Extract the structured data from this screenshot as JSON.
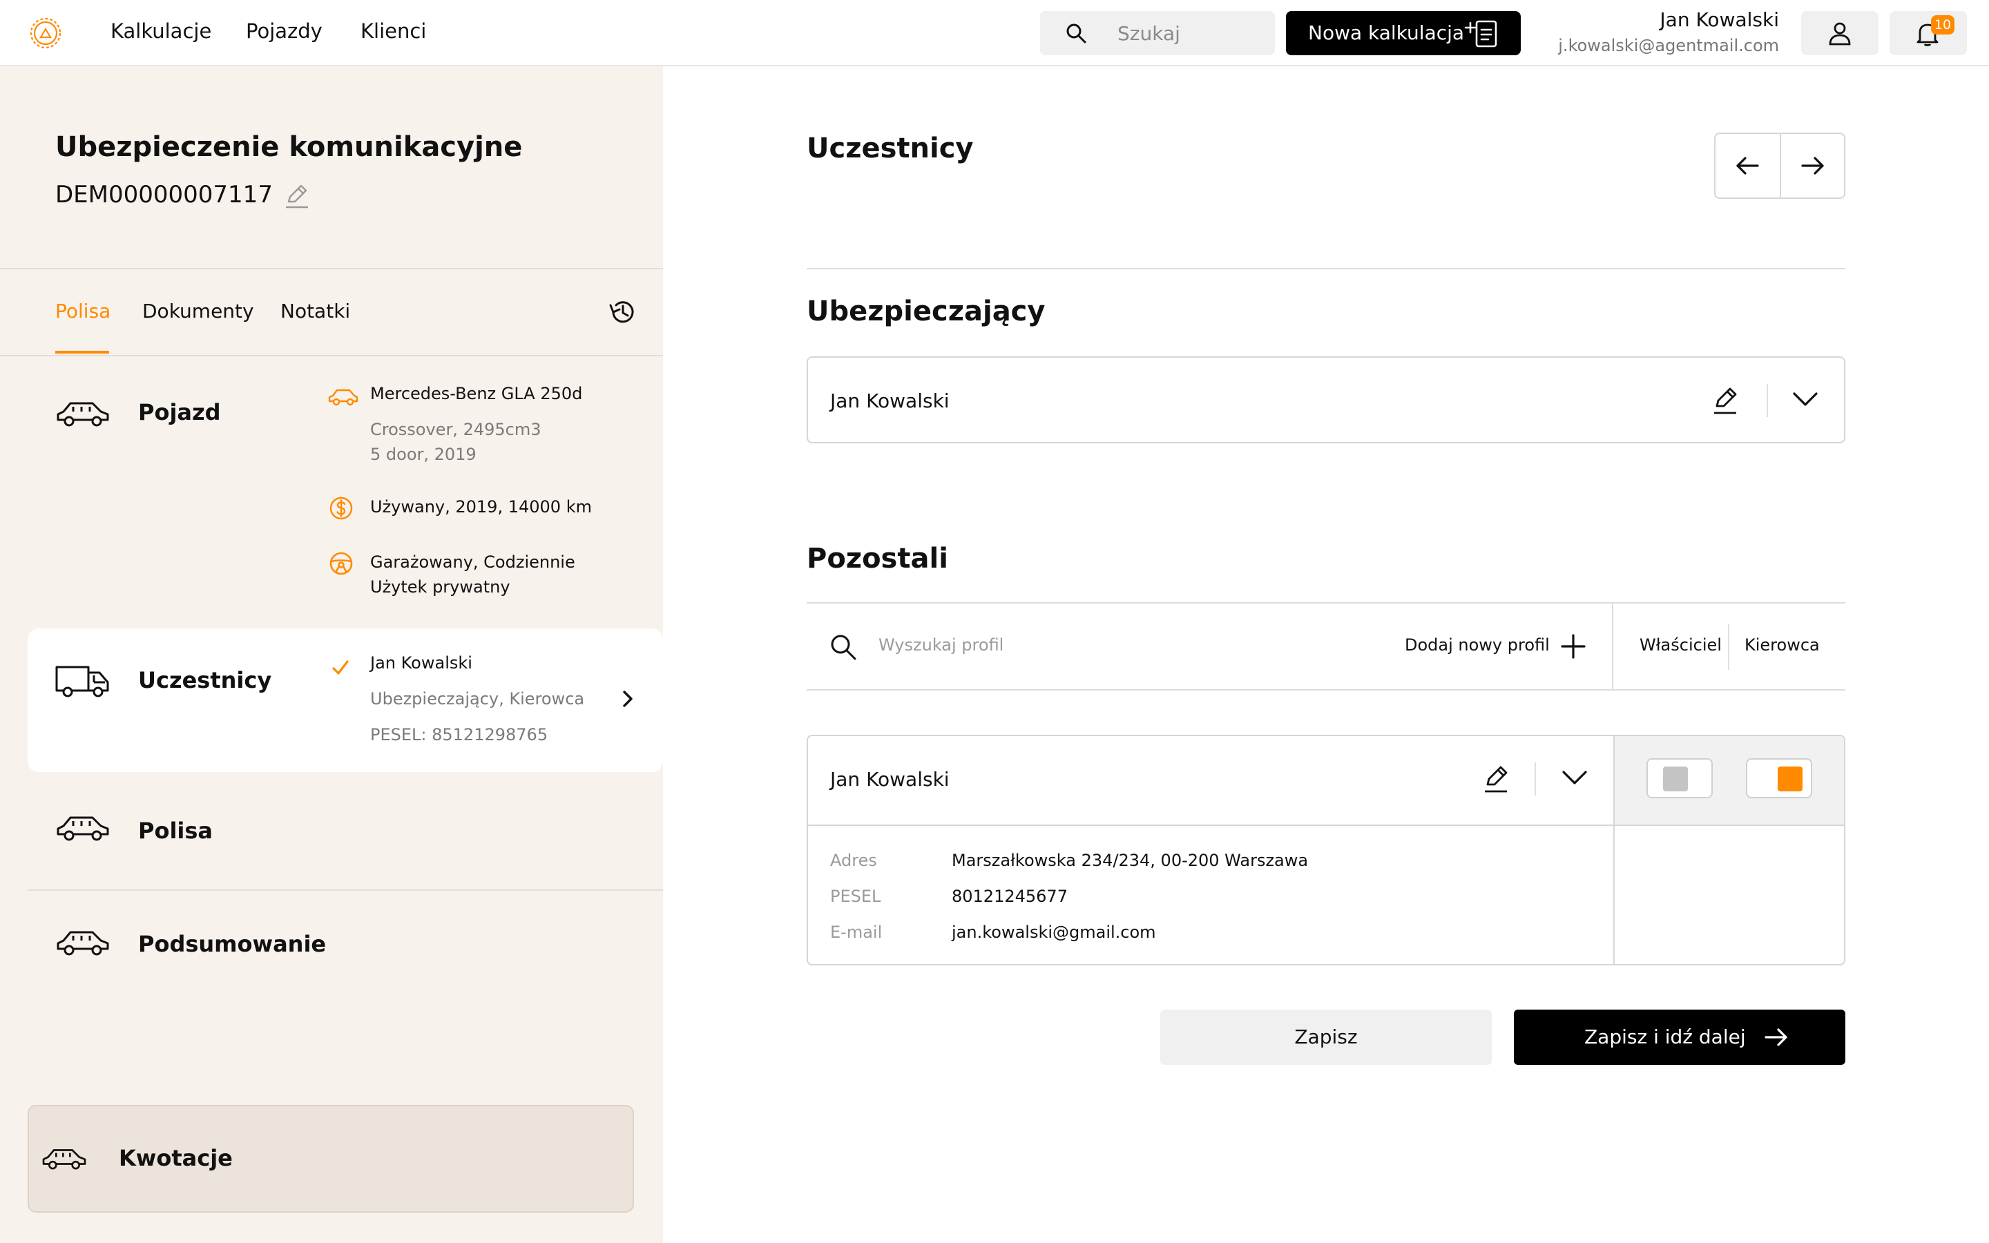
{
  "header": {
    "nav": [
      "Kalkulacje",
      "Pojazdy",
      "Klienci"
    ],
    "search_placeholder": "Szukaj",
    "new_button": "Nowa kalkulacja",
    "user_name": "Jan Kowalski",
    "user_email": "j.kowalski@agentmail.com",
    "notification_count": "10",
    "logo_icon": "sun-logo-icon",
    "accent_color": "#ff8a00"
  },
  "sidebar": {
    "title": "Ubezpieczenie komunikacyjne",
    "policy_id": "DEM00000007117",
    "tabs": [
      "Polisa",
      "Dokumenty",
      "Notatki"
    ],
    "active_tab": "Polisa",
    "steps": {
      "vehicle": {
        "title": "Pojazd",
        "model": "Mercedes-Benz GLA 250d",
        "body": "Crossover, 2495cm3",
        "doors": "5 door, 2019",
        "usage": "Używany, 2019, 14000 km",
        "parking": "Garażowany, Codziennie",
        "purpose": "Użytek prywatny"
      },
      "participants": {
        "title": "Uczestnicy",
        "name": "Jan Kowalski",
        "roles": "Ubezpieczający, Kierowca",
        "pesel": "PESEL: 85121298765"
      },
      "policy": {
        "title": "Polisa"
      },
      "summary": {
        "title": "Podsumowanie"
      }
    },
    "quotes": "Kwotacje"
  },
  "main": {
    "title": "Uczestnicy",
    "insured_heading": "Ubezpieczający",
    "insured_name": "Jan Kowalski",
    "others_heading": "Pozostali",
    "filter": {
      "placeholder": "Wyszukaj profil",
      "add_label": "Dodaj nowy profil",
      "owner": "Właściciel",
      "driver": "Kierowca"
    },
    "profile": {
      "name": "Jan Kowalski",
      "address_label": "Adres",
      "address": "Marszałkowska 234/234, 00-200 Warszawa",
      "pesel_label": "PESEL",
      "pesel": "80121245677",
      "email_label": "E-mail",
      "email": "jan.kowalski@gmail.com",
      "owner_selected": false,
      "driver_selected": true
    },
    "save_button": "Zapisz",
    "next_button": "Zapisz i idź dalej"
  }
}
